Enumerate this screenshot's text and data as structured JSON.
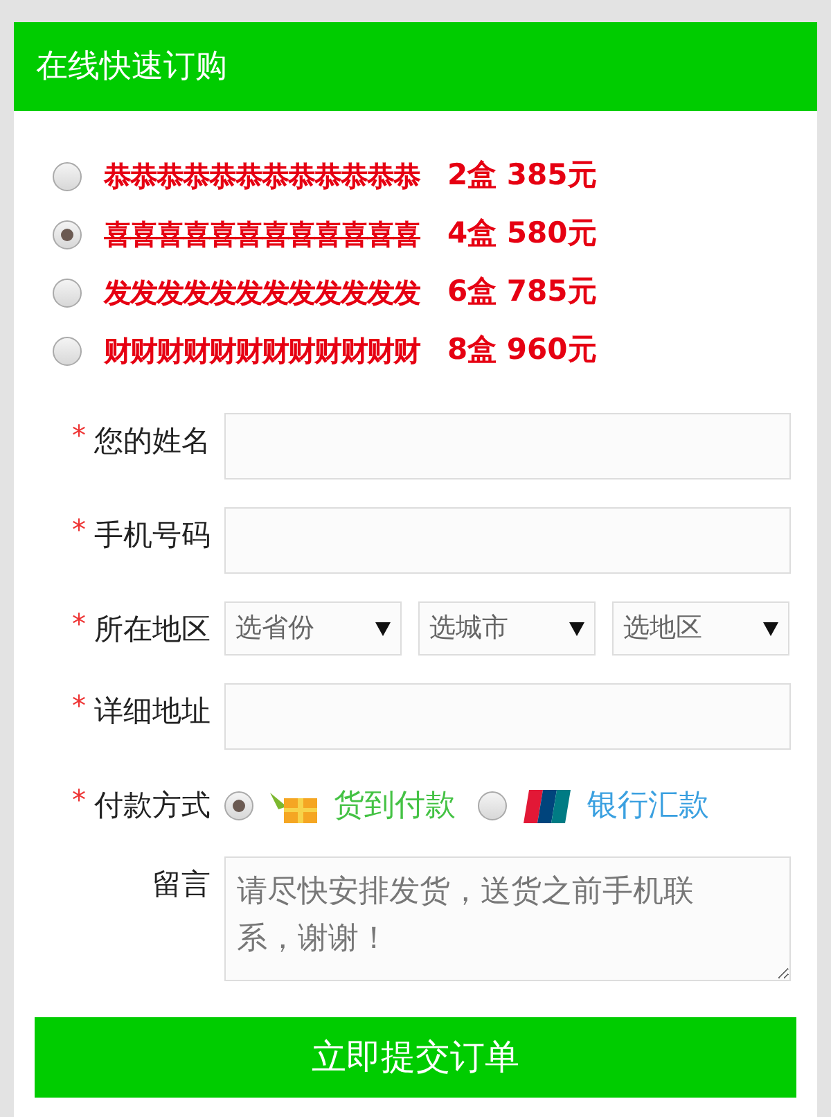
{
  "header": {
    "title": "在线快速订购"
  },
  "packages": [
    {
      "name": "恭恭恭恭恭恭恭恭恭恭恭恭",
      "price": "2盒 385元",
      "selected": false
    },
    {
      "name": "喜喜喜喜喜喜喜喜喜喜喜喜",
      "price": "4盒 580元",
      "selected": true
    },
    {
      "name": "发发发发发发发发发发发发",
      "price": "6盒 785元",
      "selected": false
    },
    {
      "name": "财财财财财财财财财财财财",
      "price": "8盒 960元",
      "selected": false
    }
  ],
  "fields": [
    {
      "kind": "text",
      "mark": "*",
      "label": "您的姓名"
    },
    {
      "kind": "text",
      "mark": "*",
      "label": "手机号码"
    },
    {
      "kind": "region",
      "mark": "*",
      "label": "所在地区",
      "selects": [
        "选省份",
        "选城市",
        "选地区"
      ]
    },
    {
      "kind": "text",
      "mark": "*",
      "label": "详细地址"
    },
    {
      "kind": "payment",
      "mark": "*",
      "label": "付款方式",
      "options": [
        {
          "label": "货到付款",
          "selected": true
        },
        {
          "label": "银行汇款",
          "selected": false
        }
      ]
    },
    {
      "kind": "textarea",
      "label": "留言",
      "placeholder": "请尽快安排发货，送货之前手机联系，谢谢！"
    }
  ],
  "submit": {
    "label": "立即提交订单"
  }
}
